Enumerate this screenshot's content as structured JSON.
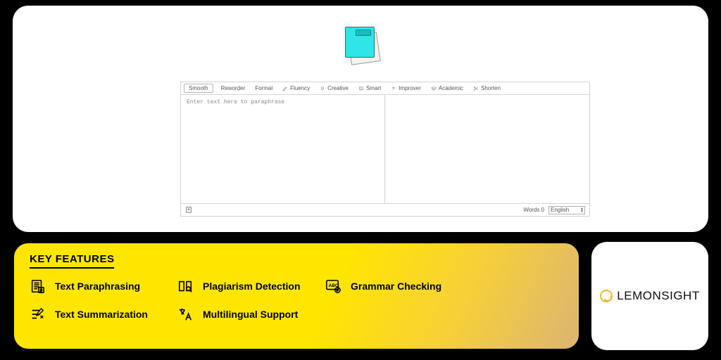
{
  "editor": {
    "tabs": [
      {
        "label": "Smooth",
        "icon": null,
        "active": true
      },
      {
        "label": "Reworder",
        "icon": null,
        "active": false
      },
      {
        "label": "Formal",
        "icon": null,
        "active": false
      },
      {
        "label": "Fluency",
        "icon": "pen-icon",
        "active": false
      },
      {
        "label": "Creative",
        "icon": "bulb-icon",
        "active": false
      },
      {
        "label": "Smart",
        "icon": "brain-icon",
        "active": false
      },
      {
        "label": "Improver",
        "icon": "up-icon",
        "active": false
      },
      {
        "label": "Academic",
        "icon": "grad-icon",
        "active": false
      },
      {
        "label": "Shorten",
        "icon": "cut-icon",
        "active": false
      }
    ],
    "placeholder": "Enter text here to paraphrase",
    "words_label": "Words 0",
    "language_selected": "English"
  },
  "features": {
    "title": "KEY FEATURES",
    "items": [
      "Text Paraphrasing",
      "Plagiarism Detection",
      "Grammar Checking",
      "Text Summarization",
      "Multilingual Support"
    ]
  },
  "brand": {
    "name": "LEMONSIGHT"
  }
}
